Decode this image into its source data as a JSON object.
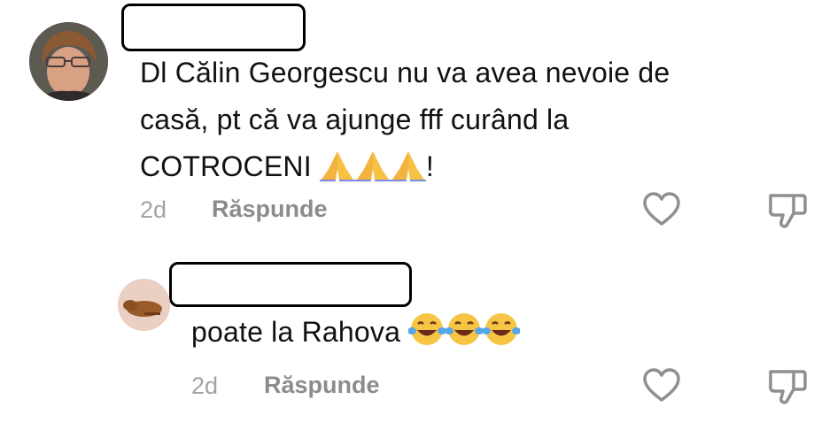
{
  "comments": [
    {
      "username": "",
      "lines": [
        "Dl Călin Georgescu nu va avea nevoie de",
        "casă, pt că va ajunge fff curând la",
        "COTROCENI"
      ],
      "trailing": "!",
      "emojis": [
        "folded-hands",
        "folded-hands",
        "folded-hands"
      ],
      "time": "2d",
      "reply_label": "Răspunde"
    },
    {
      "username": "",
      "text": "poate la Rahova",
      "emojis": [
        "tears-of-joy",
        "tears-of-joy",
        "tears-of-joy"
      ],
      "time": "2d",
      "reply_label": "Răspunde"
    }
  ],
  "icons": [
    "heart-icon",
    "dislike-icon"
  ]
}
